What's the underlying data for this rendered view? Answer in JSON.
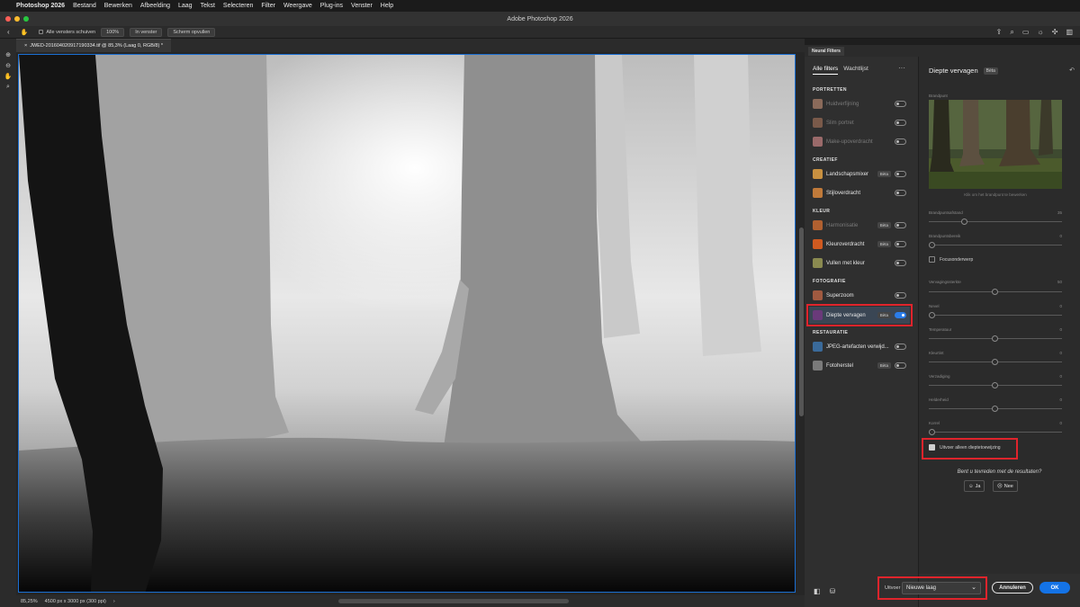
{
  "menubar": {
    "app": "Photoshop 2026",
    "items": [
      "Bestand",
      "Bewerken",
      "Afbeelding",
      "Laag",
      "Tekst",
      "Selecteren",
      "Filter",
      "Weergave",
      "Plug-ins",
      "Venster",
      "Help"
    ]
  },
  "window": {
    "title": "Adobe Photoshop 2026"
  },
  "options": {
    "scroll_all_label": "Alle vensters schuiven",
    "zoom_100": "100%",
    "fit_window": "In venster",
    "fill_screen": "Scherm opvullen"
  },
  "document": {
    "tab_title": "JWED-20160402091719033​4.tif @ 85,3% (Laag 0, RGB/8) *",
    "zoom": "85,25%",
    "dimensions": "4500 px x 3000 px (300 ppi)"
  },
  "neural_filters": {
    "header_tab": "Neural Filters",
    "tab_all": "Alle filters",
    "tab_waitlist": "Wachtlijst",
    "more_icon": "more-dots-icon",
    "sections": {
      "portraits": "PORTRETTEN",
      "creative": "CREATIEF",
      "color": "KLEUR",
      "photography": "FOTOGRAFIE",
      "restoration": "RESTAURATIE"
    },
    "filters": {
      "skin": "Huidverfijning",
      "smart_portrait": "Slim portret",
      "makeup": "Make-upoverdracht",
      "landscape": "Landschapsmixer",
      "style": "Stijloverdracht",
      "harmonize": "Harmonisatie",
      "color_transfer": "Kleuroverdracht",
      "colorize": "Vullen met kleur",
      "superzoom": "Superzoom",
      "depth_blur": "Diepte vervagen",
      "jpeg": "JPEG-artefacten verwijd...",
      "photo_restore": "Fotoherstel"
    },
    "beta_label": "Bèta"
  },
  "depth_blur": {
    "title": "Diepte vervagen",
    "beta": "Bèta",
    "focal_point": "Brandpunt",
    "preview_caption": "Klik om het brandpunt te bewerken",
    "focal_distance": "Brandpuntsafstand",
    "focal_distance_value": "35",
    "focal_range": "Brandpuntsbereik",
    "focal_range_value": "0",
    "focus_subject": "Focusonderwerp",
    "blur_strength": "Vervagingssterkte",
    "blur_strength_value": "50",
    "haze": "Nevel",
    "haze_value": "0",
    "temperature": "Temperatuur",
    "temperature_value": "0",
    "tint": "Kleurtint",
    "tint_value": "0",
    "saturation": "Verzadiging",
    "saturation_value": "0",
    "brightness": "Helderheid",
    "brightness_value": "0",
    "grain": "Korrel",
    "grain_value": "0",
    "output_depth_only": "Uitvoer alleen dieptetoewijzing"
  },
  "feedback": {
    "question": "Bent u tevreden met de resultaten?",
    "yes": "Ja",
    "no": "Nee"
  },
  "footer": {
    "output_label": "Uitvoer",
    "output_value": "Nieuwe laag",
    "cancel": "Annuleren",
    "ok": "OK"
  },
  "colors": {
    "accent": "#1473e6",
    "highlight": "#e0242c"
  }
}
